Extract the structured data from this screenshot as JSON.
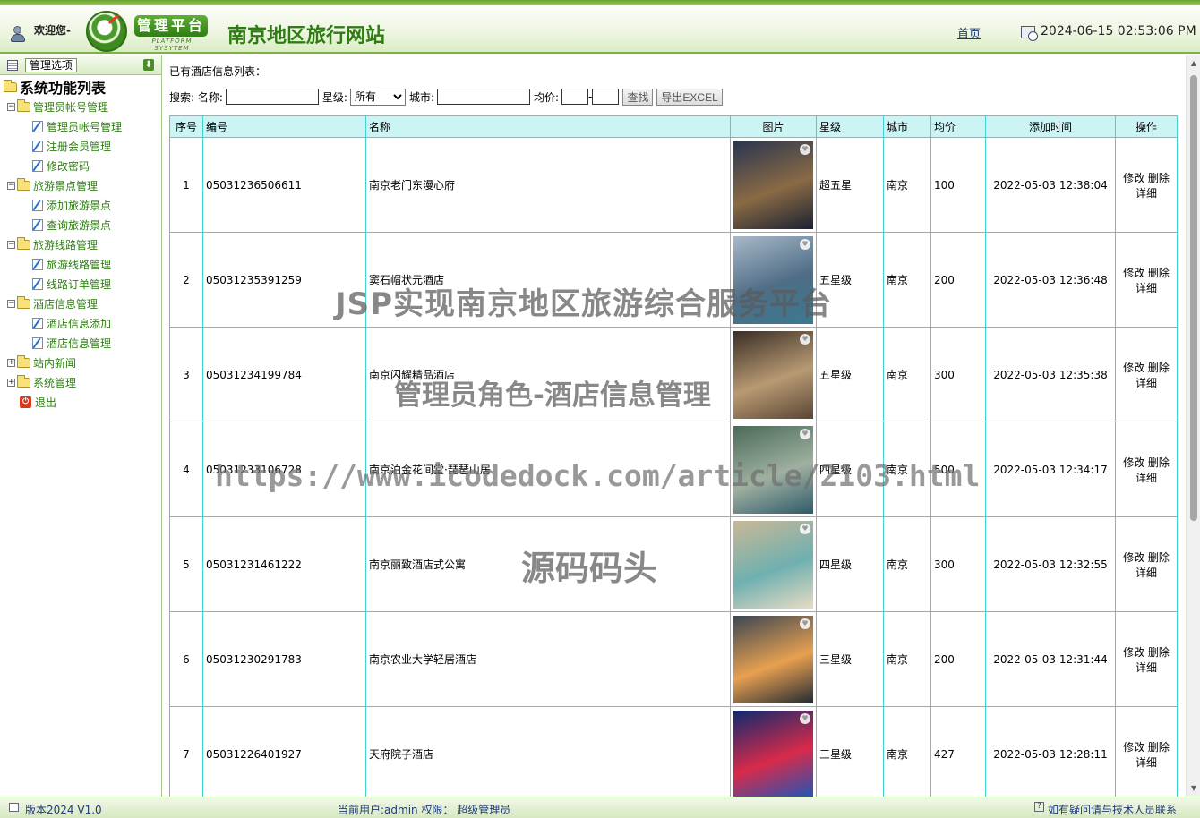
{
  "header": {
    "welcome": "欢迎您-",
    "platform_badge": "管理平台",
    "platform_sub": "PLATFORM SYSYTEM",
    "site_title": "南京地区旅行网站",
    "home_link": "首页",
    "datetime": "2024-06-15 02:53:06 PM"
  },
  "sidebar": {
    "header_label": "管理选项",
    "root": "系统功能列表",
    "groups": [
      {
        "label": "管理员帐号管理",
        "items": [
          "管理员帐号管理",
          "注册会员管理",
          "修改密码"
        ]
      },
      {
        "label": "旅游景点管理",
        "items": [
          "添加旅游景点",
          "查询旅游景点"
        ]
      },
      {
        "label": "旅游线路管理",
        "items": [
          "旅游线路管理",
          "线路订单管理"
        ]
      },
      {
        "label": "酒店信息管理",
        "items": [
          "酒店信息添加",
          "酒店信息管理"
        ]
      },
      {
        "label": "站内新闻",
        "items": []
      },
      {
        "label": "系统管理",
        "items": []
      }
    ],
    "logout": "退出"
  },
  "main": {
    "list_title": "已有酒店信息列表：",
    "search": {
      "prefix": "搜索: 名称:",
      "star_label": "星级:",
      "star_selected": "所有",
      "city_label": "城市:",
      "price_label": "均价:",
      "price_sep": "-",
      "search_button": "查找",
      "export_button": "导出EXCEL"
    },
    "columns": [
      "序号",
      "编号",
      "名称",
      "图片",
      "星级",
      "城市",
      "均价",
      "添加时间",
      "操作"
    ],
    "rows": [
      {
        "seq": "1",
        "code": "05031236506611",
        "name": "南京老门东漫心府",
        "star": "超五星",
        "city": "南京",
        "price": "100",
        "time": "2022-05-03 12:38:04"
      },
      {
        "seq": "2",
        "code": "05031235391259",
        "name": "窦石帽状元酒店",
        "star": "五星级",
        "city": "南京",
        "price": "200",
        "time": "2022-05-03 12:36:48"
      },
      {
        "seq": "3",
        "code": "05031234199784",
        "name": "南京闪耀精品酒店",
        "star": "五星级",
        "city": "南京",
        "price": "300",
        "time": "2022-05-03 12:35:38"
      },
      {
        "seq": "4",
        "code": "05031233106728",
        "name": "南京泊金花间堂·琵琶山居",
        "star": "四星级",
        "city": "南京",
        "price": "500",
        "time": "2022-05-03 12:34:17"
      },
      {
        "seq": "5",
        "code": "05031231461222",
        "name": "南京丽致酒店式公寓",
        "star": "四星级",
        "city": "南京",
        "price": "300",
        "time": "2022-05-03 12:32:55"
      },
      {
        "seq": "6",
        "code": "05031230291783",
        "name": "南京农业大学轻居酒店",
        "star": "三星级",
        "city": "南京",
        "price": "200",
        "time": "2022-05-03 12:31:44"
      },
      {
        "seq": "7",
        "code": "05031226401927",
        "name": "天府院子酒店",
        "star": "三星级",
        "city": "南京",
        "price": "427",
        "time": "2022-05-03 12:28:11"
      }
    ],
    "ops": {
      "edit": "修改",
      "delete": "删除",
      "detail": "详细"
    }
  },
  "watermarks": {
    "line1": "JSP实现南京地区旅游综合服务平台",
    "line2": "管理员角色-酒店信息管理",
    "line3": "https://www.icodedock.com/article/2103.html",
    "line4": "源码码头"
  },
  "footer": {
    "version": "版本2024 V1.0",
    "user_info": "当前用户:admin 权限： 超级管理员",
    "contact": "如有疑问请与技术人员联系"
  },
  "thumb_colors": [
    [
      "#2a3550",
      "#8a6a44",
      "#1b2233"
    ],
    [
      "#a8b8c8",
      "#4f6d86",
      "#3a7a90"
    ],
    [
      "#3a2e25",
      "#b89a72",
      "#5a4636"
    ],
    [
      "#4a6a58",
      "#9fb0a0",
      "#2f5a6a"
    ],
    [
      "#c9b896",
      "#6fb0b0",
      "#e8dcc4"
    ],
    [
      "#3b4652",
      "#e8a050",
      "#232a33"
    ],
    [
      "#0d2a6e",
      "#d82a4a",
      "#1e56b8"
    ]
  ]
}
